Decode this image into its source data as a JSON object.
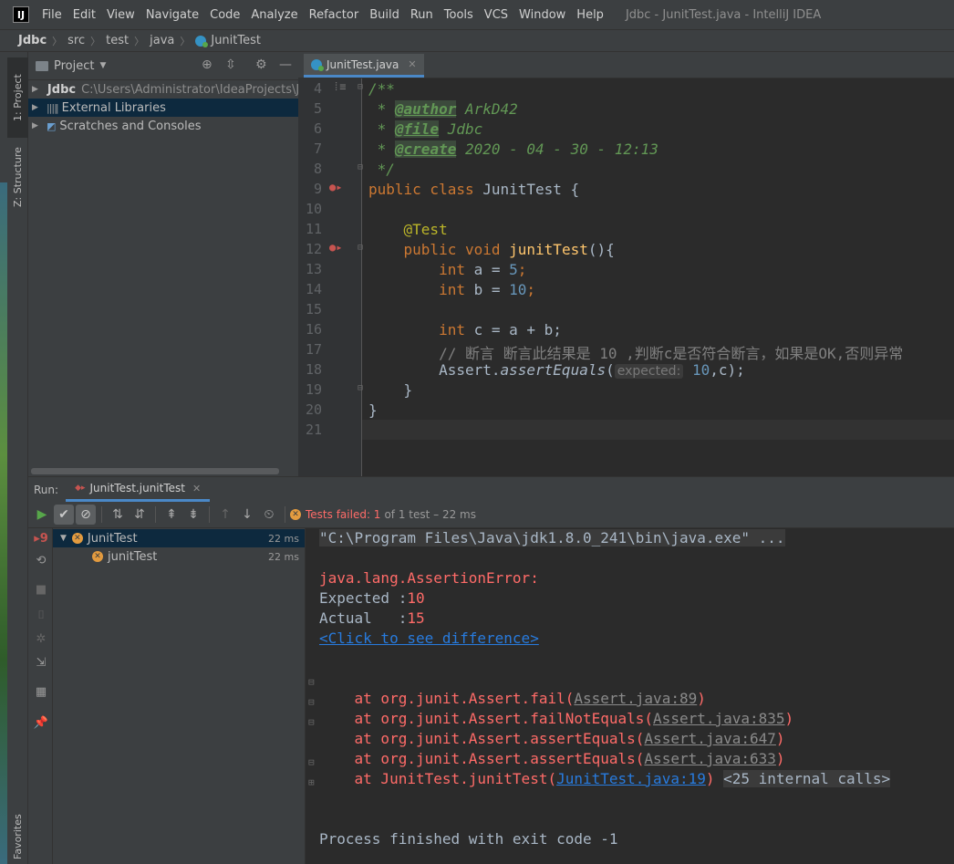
{
  "app": {
    "logo_text": "IJ",
    "menu": [
      "File",
      "Edit",
      "View",
      "Navigate",
      "Code",
      "Analyze",
      "Refactor",
      "Build",
      "Run",
      "Tools",
      "VCS",
      "Window",
      "Help"
    ],
    "window_title": "Jdbc - JunitTest.java - IntelliJ IDEA"
  },
  "breadcrumb": {
    "items": [
      "Jdbc",
      "src",
      "test",
      "java",
      "JunitTest"
    ]
  },
  "left_stripe": {
    "project_tab": "1: Project",
    "structure_tab": "Z: Structure",
    "favorites_tab": "Favorites"
  },
  "project_panel": {
    "title": "Project",
    "tree": [
      {
        "name": "Jdbc",
        "path": "C:\\Users\\Administrator\\IdeaProjects\\Jdbc"
      },
      {
        "name": "External Libraries"
      },
      {
        "name": "Scratches and Consoles"
      }
    ]
  },
  "editor": {
    "tab_label": "JunitTest.java",
    "line_numbers": [
      "4",
      "5",
      "6",
      "7",
      "8",
      "9",
      "10",
      "11",
      "12",
      "13",
      "14",
      "15",
      "16",
      "17",
      "18",
      "19",
      "20",
      "21"
    ],
    "javadoc": {
      "open": "/**",
      "author_tag": "@author",
      "author_val": " ArkD42",
      "file_tag": "@file",
      "file_val": " Jdbc",
      "create_tag": "@create",
      "create_val": " 2020 - 04 - 30 - 12:13",
      "close": " */"
    },
    "class_kw": "public class",
    "class_name": " JunitTest {",
    "annotation": "@Test",
    "method_kw": "public void",
    "method_name": "junitTest",
    "method_rest": "(){",
    "int_kw": "int",
    "a_decl": " a = ",
    "a_val": "5",
    "b_decl": " b = ",
    "b_val": "10",
    "c_decl": " c = a + b;",
    "comment": "// 断言 断言此结果是 10 ,判断c是否符合断言，如果是OK,否则异常",
    "assert_obj": "Assert.",
    "assert_fn": "assertEquals",
    "hint": "expected:",
    "assert_val": "10",
    "assert_rest": ",c);",
    "close_method": "}",
    "close_class": "}"
  },
  "run_panel": {
    "label": "Run:",
    "tab_label": "JunitTest.junitTest",
    "status_failed": "Tests failed: 1",
    "status_rest": "of 1 test – 22 ms",
    "tree": [
      {
        "name": "JunitTest",
        "duration": "22 ms"
      },
      {
        "name": "junitTest",
        "duration": "22 ms"
      }
    ],
    "console": {
      "cmd": "\"C:\\Program Files\\Java\\jdk1.8.0_241\\bin\\java.exe\" ...",
      "error": "java.lang.AssertionError:",
      "expected_label": "Expected :",
      "expected_val": "10",
      "actual_label": "Actual   :",
      "actual_val": "15",
      "diff_link": "<Click to see difference>",
      "stack": [
        {
          "prefix": "at org.junit.Assert.fail(",
          "loc": "Assert.java:89",
          "suffix": ")"
        },
        {
          "prefix": "at org.junit.Assert.failNotEquals(",
          "loc": "Assert.java:835",
          "suffix": ")"
        },
        {
          "prefix": "at org.junit.Assert.assertEquals(",
          "loc": "Assert.java:647",
          "suffix": ")"
        },
        {
          "prefix": "at org.junit.Assert.assertEquals(",
          "loc": "Assert.java:633",
          "suffix": ")"
        },
        {
          "prefix": "at JunitTest.junitTest(",
          "loc": "JunitTest.java:19",
          "suffix": ")"
        }
      ],
      "internal_calls": "<25 internal calls>",
      "exit": "Process finished with exit code -1"
    }
  },
  "colors": {
    "accent": "#4a88c7",
    "error": "#ff6b68",
    "link": "#287bde",
    "keyword": "#cc7832"
  }
}
